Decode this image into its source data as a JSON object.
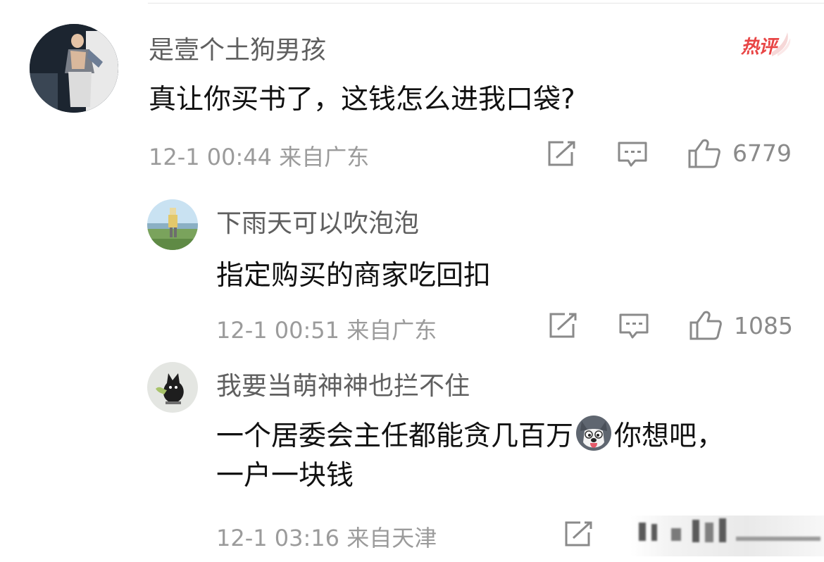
{
  "comments": [
    {
      "username": "是壹个土狗男孩",
      "text": "真让你买书了，这钱怎么进我口袋?",
      "meta": "12-1 00:44 来自广东",
      "likes": "6779",
      "badge": "热评"
    },
    {
      "username": "下雨天可以吹泡泡",
      "text": "指定购买的商家吃回扣",
      "meta": "12-1 00:51 来自广东",
      "likes": "1085"
    },
    {
      "username": "我要当萌神神也拦不住",
      "text_before_emoji": "一个居委会主任都能贪几百万",
      "emoji": "husky-emoji",
      "text_after_emoji": "你想吧，一户一块钱",
      "meta": "12-1 03:16 来自天津"
    }
  ],
  "icons": {
    "share": "share-icon",
    "reply": "comment-icon",
    "like": "thumbs-up-icon"
  },
  "colors": {
    "username": "#5f5f5f",
    "text": "#111111",
    "meta": "#9b9b9b",
    "hot_badge": "#e84545"
  }
}
